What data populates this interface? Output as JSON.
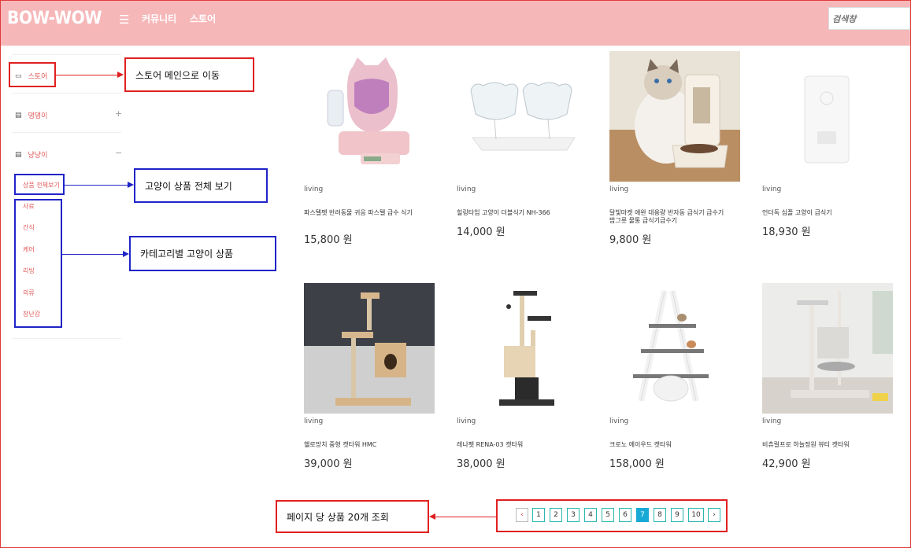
{
  "header": {
    "logo": "BOW-WOW",
    "nav": [
      "커뮤니티",
      "스토어"
    ],
    "search_placeholder": "검색창"
  },
  "sidebar": {
    "store": "스토어",
    "dog": "댕댕이",
    "cat": "냥냥이",
    "dog_toggle": "+",
    "cat_toggle": "−",
    "cat_all": "상품 전체보기",
    "cat_items": [
      "사료",
      "간식",
      "케어",
      "리빙",
      "의류",
      "장난감"
    ]
  },
  "callouts": {
    "store_main": "스토어 메인으로 이동",
    "cat_all": "고양이 상품 전체 보기",
    "cat_category": "카테고리별 고양이 상품",
    "per_page": "페이지 당 상품 20개 조회"
  },
  "products": [
    {
      "category": "living",
      "name": "파스텔펫 반려동물 귀음 파스텔 급수 식기",
      "price": "15,800 원"
    },
    {
      "category": "living",
      "name": "힐링타임 고양이 더블식기 NH-366",
      "price": "14,000 원"
    },
    {
      "category": "living",
      "name": "달빛마켓 애완 대용량 반자동 급식기 급수기 밥그릇 물통 급식기급수기",
      "price": "9,800 원"
    },
    {
      "category": "living",
      "name": "언더독 심플 고양이 급식기",
      "price": "18,930 원"
    },
    {
      "category": "living",
      "name": "헬로망치 중형 캣타워 HMC",
      "price": "39,000 원"
    },
    {
      "category": "living",
      "name": "레나펫 RENA-03 캣타워",
      "price": "38,000 원"
    },
    {
      "category": "living",
      "name": "크로노 에이우드 캣타워",
      "price": "158,000 원"
    },
    {
      "category": "living",
      "name": "비츄럴프로 하늘정원 뷰티 캣타워",
      "price": "42,900 원"
    }
  ],
  "pagination": {
    "prev": "‹",
    "next": "›",
    "pages": [
      "1",
      "2",
      "3",
      "4",
      "5",
      "6",
      "7",
      "8",
      "9",
      "10"
    ],
    "current": "7"
  },
  "colors": {
    "header_bg": "#f6b7b9",
    "accent_red": "#e02020",
    "accent_blue": "#2024c8",
    "pagination_active": "#18a9d6"
  }
}
